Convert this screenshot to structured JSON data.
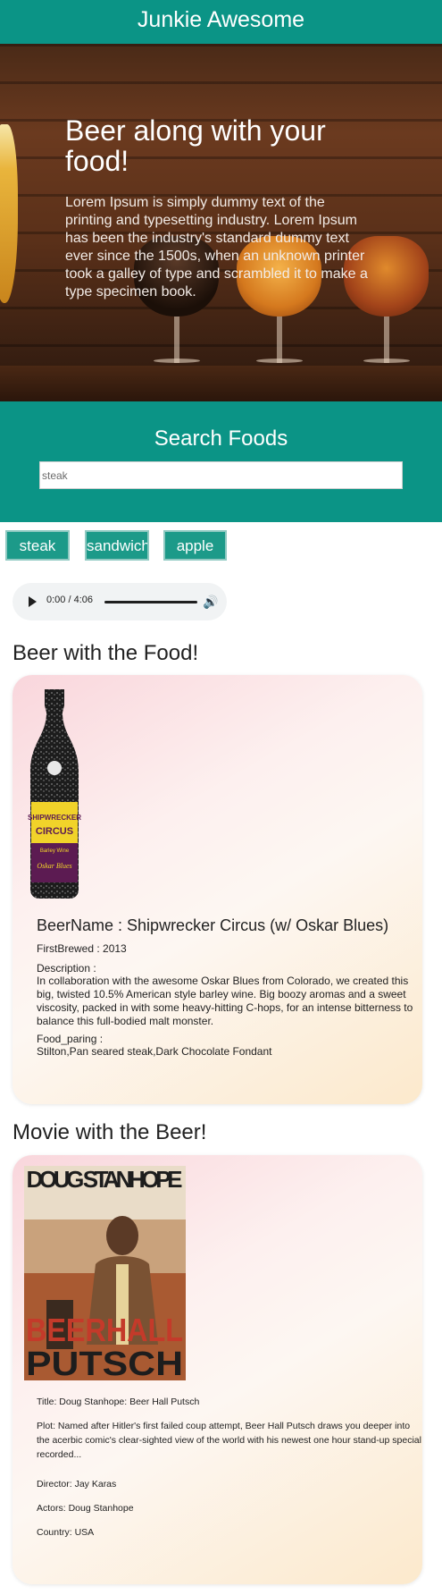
{
  "header": {
    "title": "Junkie Awesome"
  },
  "hero": {
    "title": "Beer along with your food!",
    "text": "Lorem Ipsum is simply dummy text of the printing and typesetting industry. Lorem Ipsum has been the industry's standard dummy text ever since the 1500s, when an unknown printer took a galley of type and scrambled it to make a type specimen book."
  },
  "search": {
    "title": "Search Foods",
    "value": "steak",
    "placeholder": "steak"
  },
  "chips": [
    "steak",
    "sandwich",
    "apple"
  ],
  "audio": {
    "time": "0:00 / 4:06",
    "progress": 0
  },
  "beer_section": {
    "title": "Beer with the Food!",
    "image_alt": "Shipwrecker Circus bottle",
    "bottle_label_top": "SHIPWRECKER",
    "bottle_label_mid": "CIRCUS",
    "bottle_label_sub": "Barley Wine",
    "bottle_label_bottom": "Oskar Blues",
    "name": "BeerName : Shipwrecker Circus (w/ Oskar Blues)",
    "first_brewed": "FirstBrewed : 2013",
    "description_label": "Description :",
    "description": "In collaboration with the awesome Oskar Blues from Colorado, we created this big, twisted 10.5% American style barley wine. Big boozy aromas and a sweet viscosity, packed in with some heavy-hitting C-hops, for an intense bitterness to balance this full-bodied malt monster.",
    "food_pairing_label": "Food_paring :",
    "food_pairing": "Stilton,Pan seared steak,Dark Chocolate Fondant"
  },
  "movie_section": {
    "title": "Movie with the Beer!",
    "poster_top": "DOUG STANHOPE",
    "poster_bottom_1": "BEERHALL",
    "poster_bottom_2": "PUTSCH",
    "title_line": "Title: Doug Stanhope: Beer Hall Putsch",
    "plot": "Plot: Named after Hitler's first failed coup attempt, Beer Hall Putsch draws you deeper into the acerbic comic's clear-sighted view of the world with his newest one hour stand-up special recorded...",
    "director": "Director: Jay Karas",
    "actors": "Actors: Doug Stanhope",
    "country": "Country: USA"
  }
}
